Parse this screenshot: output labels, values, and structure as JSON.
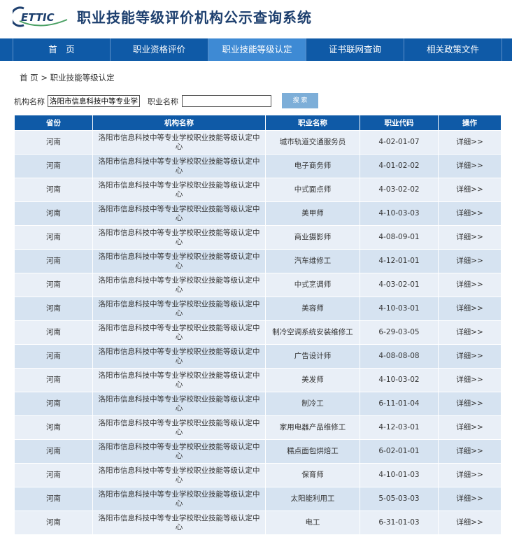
{
  "header": {
    "logo_text": "ETTIC",
    "title": "职业技能等级评价机构公示查询系统"
  },
  "nav": [
    {
      "label": "首　页"
    },
    {
      "label": "职业资格评价"
    },
    {
      "label": "职业技能等级认定"
    },
    {
      "label": "证书联网查询"
    },
    {
      "label": "相关政策文件"
    }
  ],
  "breadcrumb": {
    "home": "首 页",
    "separator": ">",
    "current": "职业技能等级认定"
  },
  "search": {
    "org_label": "机构名称",
    "org_value": "洛阳市信息科技中等专业学校职业技能等级认定中心",
    "job_label": "职业名称",
    "job_value": "",
    "button_label": "搜 索"
  },
  "table": {
    "headers": [
      "省份",
      "机构名称",
      "职业名称",
      "职业代码",
      "操作"
    ],
    "rows": [
      [
        "河南",
        "洛阳市信息科技中等专业学校职业技能等级认定中心",
        "城市轨道交通服务员",
        "4-02-01-07",
        "详细>>"
      ],
      [
        "河南",
        "洛阳市信息科技中等专业学校职业技能等级认定中心",
        "电子商务师",
        "4-01-02-02",
        "详细>>"
      ],
      [
        "河南",
        "洛阳市信息科技中等专业学校职业技能等级认定中心",
        "中式面点师",
        "4-03-02-02",
        "详细>>"
      ],
      [
        "河南",
        "洛阳市信息科技中等专业学校职业技能等级认定中心",
        "美甲师",
        "4-10-03-03",
        "详细>>"
      ],
      [
        "河南",
        "洛阳市信息科技中等专业学校职业技能等级认定中心",
        "商业摄影师",
        "4-08-09-01",
        "详细>>"
      ],
      [
        "河南",
        "洛阳市信息科技中等专业学校职业技能等级认定中心",
        "汽车维修工",
        "4-12-01-01",
        "详细>>"
      ],
      [
        "河南",
        "洛阳市信息科技中等专业学校职业技能等级认定中心",
        "中式烹调师",
        "4-03-02-01",
        "详细>>"
      ],
      [
        "河南",
        "洛阳市信息科技中等专业学校职业技能等级认定中心",
        "美容师",
        "4-10-03-01",
        "详细>>"
      ],
      [
        "河南",
        "洛阳市信息科技中等专业学校职业技能等级认定中心",
        "制冷空调系统安装维修工",
        "6-29-03-05",
        "详细>>"
      ],
      [
        "河南",
        "洛阳市信息科技中等专业学校职业技能等级认定中心",
        "广告设计师",
        "4-08-08-08",
        "详细>>"
      ],
      [
        "河南",
        "洛阳市信息科技中等专业学校职业技能等级认定中心",
        "美发师",
        "4-10-03-02",
        "详细>>"
      ],
      [
        "河南",
        "洛阳市信息科技中等专业学校职业技能等级认定中心",
        "制冷工",
        "6-11-01-04",
        "详细>>"
      ],
      [
        "河南",
        "洛阳市信息科技中等专业学校职业技能等级认定中心",
        "家用电器产品维修工",
        "4-12-03-01",
        "详细>>"
      ],
      [
        "河南",
        "洛阳市信息科技中等专业学校职业技能等级认定中心",
        "糕点面包烘焙工",
        "6-02-01-01",
        "详细>>"
      ],
      [
        "河南",
        "洛阳市信息科技中等专业学校职业技能等级认定中心",
        "保育师",
        "4-10-01-03",
        "详细>>"
      ],
      [
        "河南",
        "洛阳市信息科技中等专业学校职业技能等级认定中心",
        "太阳能利用工",
        "5-05-03-03",
        "详细>>"
      ],
      [
        "河南",
        "洛阳市信息科技中等专业学校职业技能等级认定中心",
        "电工",
        "6-31-01-03",
        "详细>>"
      ]
    ]
  },
  "colors": {
    "nav_bg": "#0f5aa7",
    "nav_active": "#3e8ad4",
    "title": "#1d3f6e",
    "row_odd": "#e9eff7",
    "row_even": "#d6e3f1",
    "button": "#7daed8"
  }
}
